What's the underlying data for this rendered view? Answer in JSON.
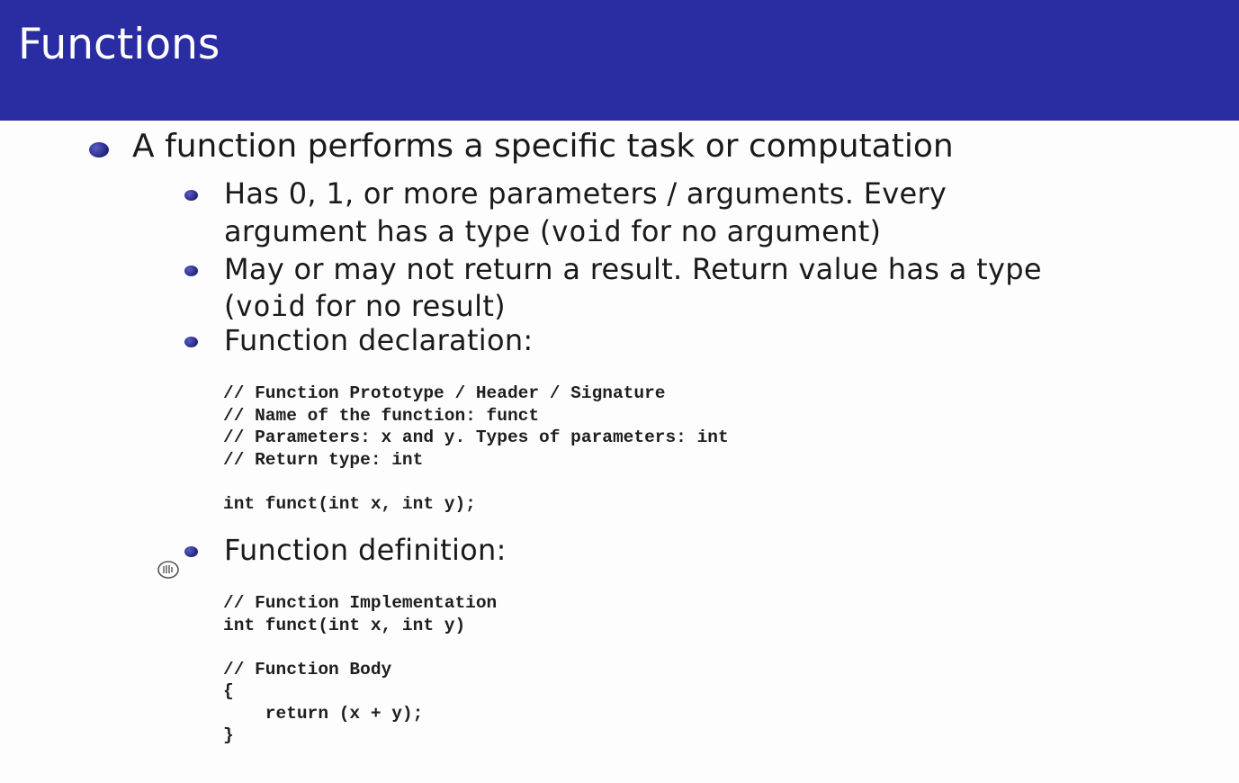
{
  "slide": {
    "title": "Functions",
    "bullet1": "A function performs a specific task or computation",
    "sub1_line1": "Has 0, 1, or more parameters / arguments. Every",
    "sub1_line2_a": "argument has a type (",
    "sub1_line2_code": "void",
    "sub1_line2_b": " for no argument)",
    "sub2_line1": "May or may not return a result. Return value has a type",
    "sub2_line2_a": "(",
    "sub2_line2_code": "void",
    "sub2_line2_b": " for no result)",
    "sub3": "Function declaration:",
    "code_decl": [
      "// Function Prototype / Header / Signature",
      "// Name of the function: funct",
      "// Parameters: x and y. Types of parameters: int",
      "// Return type: int",
      "",
      "int funct(int x, int y);"
    ],
    "sub4": "Function definition:",
    "code_def": [
      "// Function Implementation",
      "int funct(int x, int y)",
      "",
      "// Function Body",
      "{",
      "    return (x + y);",
      "}"
    ]
  },
  "colors": {
    "title_bar": "#2a2ca2",
    "bullet": "#23247a",
    "text": "#1a1a1a"
  },
  "icons": {
    "cursor": "pointer-cursor-icon"
  }
}
